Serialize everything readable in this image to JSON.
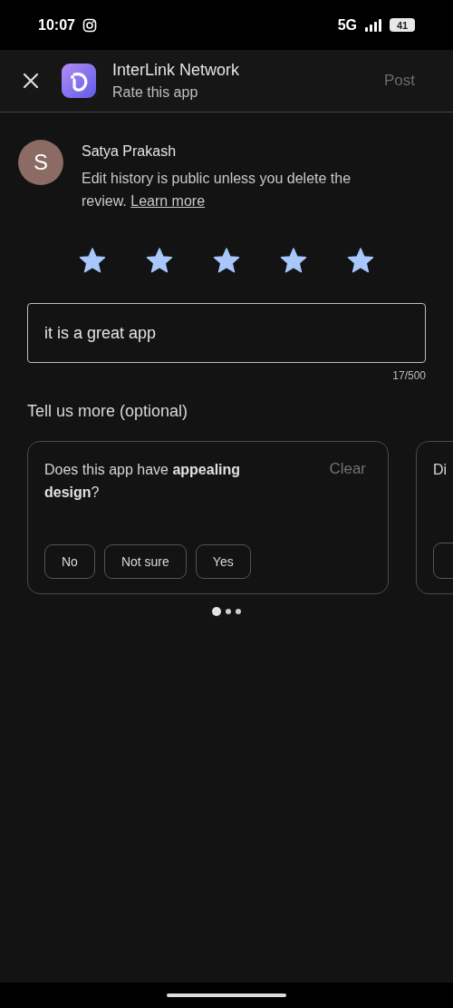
{
  "status_bar": {
    "time": "10:07",
    "network": "5G",
    "battery": "41"
  },
  "header": {
    "title": "InterLink Network",
    "subtitle": "Rate this app",
    "action": "Post"
  },
  "user": {
    "initial": "S",
    "name": "Satya Prakash",
    "notice": "Edit history is public unless you delete the review.",
    "link": "Learn more"
  },
  "rating": {
    "stars": 5
  },
  "review": {
    "value": "it is a great app",
    "counter": "17/500"
  },
  "section_title": "Tell us more (optional)",
  "questions": [
    {
      "text": "Does this app have **appealing design**?",
      "clear": "Clear",
      "answers": [
        {
          "label": "No",
          "selected": false
        },
        {
          "label": "Not sure",
          "selected": false
        },
        {
          "label": "Yes",
          "selected": false
        }
      ]
    },
    {
      "text": "Di"
    }
  ],
  "pager": [
    {
      "selected": true
    },
    {
      "selected": false
    },
    {
      "selected": false
    }
  ]
}
